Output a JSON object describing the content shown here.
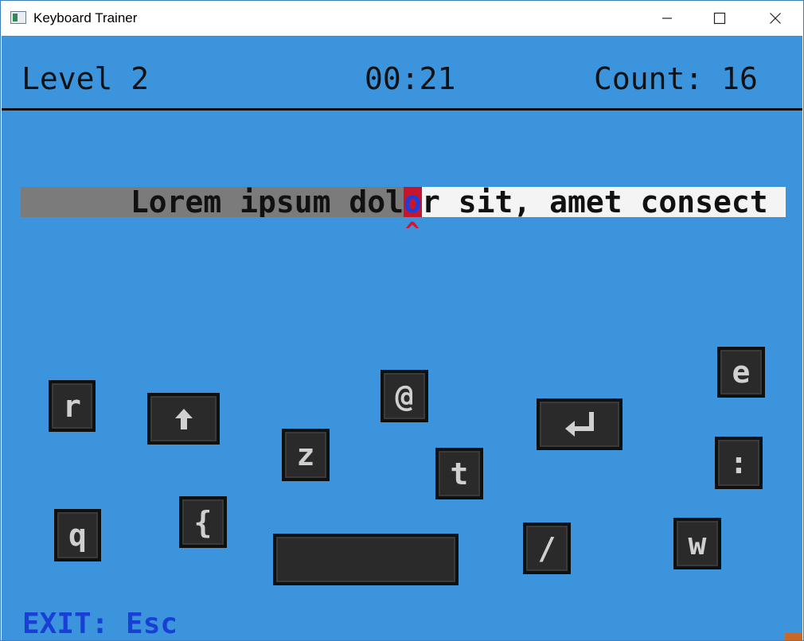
{
  "window": {
    "title": "Keyboard Trainer"
  },
  "hud": {
    "level": "Level 2",
    "timer": "00:21",
    "count": "Count: 16"
  },
  "text_line": {
    "typed": "Lorem ipsum dol",
    "current": "o",
    "untyped": "r sit, amet consect",
    "caret": "^"
  },
  "keys": {
    "r": "r",
    "up": "up-arrow-icon",
    "at": "@",
    "z": "z",
    "t": "t",
    "enter": "enter-icon",
    "e": "e",
    "colon": ":",
    "q": "q",
    "brace": "{",
    "space": "",
    "slash": "/",
    "w": "w"
  },
  "footer": {
    "exit_hint": "EXIT: Esc"
  },
  "colors": {
    "game_background": "#3b94dc",
    "typed_background": "#7b7b7b",
    "current_background": "#c8142c",
    "untyped_background": "#f4f4f4",
    "current_char": "#1c3fd8",
    "caret": "#d01830",
    "key_face": "#2a2a2a",
    "key_glyph": "#d0d0d0",
    "exit_hint": "#1a3fd6"
  }
}
